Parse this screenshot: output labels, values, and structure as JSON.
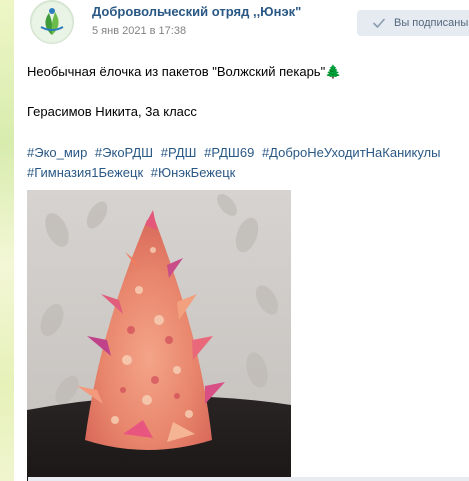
{
  "post": {
    "group_name": "Добровольческий отряд ,,Юнэк\"",
    "date": "5 янв 2021 в 17:38",
    "subscribe_label": "Вы подписаны",
    "text_line1": "Необычная ёлочка из пакетов \"Волжский пекарь\"🌲",
    "text_line2": "Герасимов Никита, 3а класс",
    "hashtags": [
      "#Эко_мир",
      "#ЭкоРДШ",
      "#РДШ",
      "#РДШ69",
      "#ДоброНеУходитНаКаникулы",
      "#Гимназия1Бежецк",
      "#ЮнэкБежецк"
    ]
  },
  "colors": {
    "link": "#2a5885",
    "meta": "#828282",
    "subscribe_bg": "#e5ebf1",
    "subscribe_text": "#55677d"
  }
}
